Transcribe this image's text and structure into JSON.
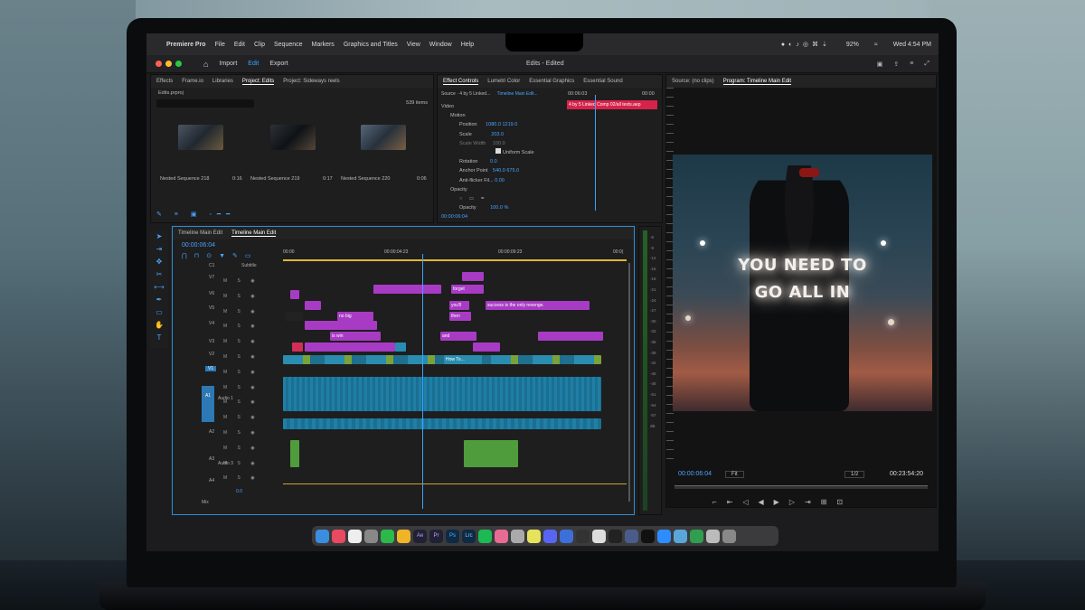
{
  "menubar": {
    "app": "Premiere Pro",
    "items": [
      "File",
      "Edit",
      "Clip",
      "Sequence",
      "Markers",
      "Graphics and Titles",
      "View",
      "Window",
      "Help"
    ],
    "battery": "92%",
    "clock": "Wed 4:54 PM"
  },
  "appbar": {
    "import": "Import",
    "edit": "Edit",
    "export": "Export",
    "title": "Edits - Edited"
  },
  "project": {
    "tabs": [
      "Effects",
      "Frame.io",
      "Libraries",
      "Project: Edits",
      "Project: Sideways reels"
    ],
    "file": "Edits.prproj",
    "count": "539 items",
    "items": [
      {
        "name": "Nested Sequence 218",
        "dur": "0:16"
      },
      {
        "name": "Nested Sequence 219",
        "dur": "0:17"
      },
      {
        "name": "Nested Sequence 220",
        "dur": "0:06"
      }
    ]
  },
  "effects": {
    "tabs": [
      "Effect Controls",
      "Lumetri Color",
      "Essential Graphics",
      "Essential Sound"
    ],
    "source": "Source · 4 by 5 Linked...",
    "seq": "Timeline Main Edit...",
    "t1": "00:06:03",
    "t2": "00:00",
    "clip": "4 by 5 Linked Comp 02/all texts.aep",
    "video": "Video",
    "motion": "Motion",
    "position": "Position",
    "pos_x": "1080.0",
    "pos_y": "1219.0",
    "scale": "Scale",
    "scale_v": "203.0",
    "scale_w": "Scale Width",
    "scale_w_v": "100.0",
    "uniform": "Uniform Scale",
    "rotation": "Rotation",
    "rot_v": "0.0",
    "anchor": "Anchor Point",
    "anc_x": "540.0",
    "anc_y": "675.0",
    "flicker": "Anti-flicker Fil...",
    "flick_v": "0.00",
    "opacity": "Opacity",
    "opacity2": "Opacity",
    "op_v": "100.0 %",
    "timecode": "00:00:06:04"
  },
  "timeline": {
    "tabs": [
      "Timeline Main Edit",
      "Timeline Main Edit"
    ],
    "timecode": "00:00:06:04",
    "ruler": [
      "00:00",
      "00:00:04:23",
      "00:00:09:23",
      "00:0("
    ],
    "tracks": [
      "C1",
      "V7",
      "V6",
      "V5",
      "V4",
      "V3",
      "V2",
      "V1",
      "A1",
      "A2",
      "A3",
      "A4"
    ],
    "subtitle": "Subtitle",
    "audio1": "Audio 1",
    "audio3": "Audio 3",
    "mix": "Mix",
    "mix_v": "0.0",
    "clips": {
      "forget": "forget",
      "youll": "you'll",
      "then": "then",
      "and": "and",
      "revenge": "success is the only revenge.",
      "big": "no big",
      "win": "is win",
      "howto": "How To..."
    },
    "meter": [
      "-6",
      "-9",
      "-12",
      "-15",
      "-18",
      "-21",
      "-24",
      "-27",
      "-30",
      "-33",
      "-36",
      "-39",
      "-42",
      "-45",
      "-48",
      "-51",
      "-54",
      "-57",
      "dB"
    ]
  },
  "program": {
    "tabs": [
      "Source: (no clips)",
      "Program: Timeline Main Edit"
    ],
    "caption1": "YOU NEED TO",
    "caption2": "GO ALL IN",
    "timecode": "00:00:06:04",
    "fit": "Fit",
    "quality": "1/2",
    "duration": "00:23:54:20"
  },
  "dock": {
    "labels": [
      "Ae",
      "Pr",
      "Ps",
      "Lrc"
    ]
  }
}
